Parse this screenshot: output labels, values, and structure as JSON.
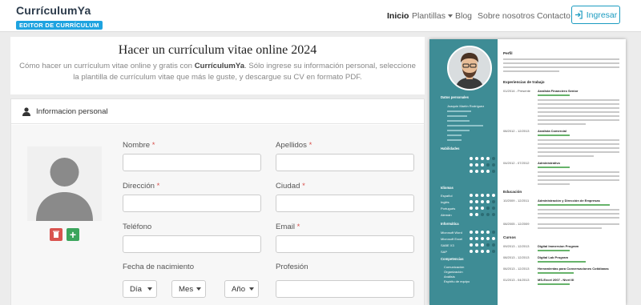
{
  "nav": {
    "logo_title": "CurrículumYa",
    "logo_subtitle": "EDITOR DE CURRÍCULUM",
    "items": [
      "Inicio",
      "Plantillas",
      "Blog",
      "Sobre nosotros",
      "Contacto"
    ],
    "login_label": "Ingresar"
  },
  "hero": {
    "title": "Hacer un currículum vitae online 2024",
    "desc_part1": "Cómo hacer un currículum vitae online y gratis con ",
    "desc_brand": "CurrículumYa",
    "desc_part2": ". Sólo ingrese su información personal, seleccione la plantilla de currículum vitae que más le guste, y descargue su CV en formato PDF."
  },
  "form": {
    "panel_title": "Informacion personal",
    "nombre": "Nombre",
    "apellidos": "Apellidos",
    "direccion": "Dirección",
    "ciudad": "Ciudad",
    "telefono": "Teléfono",
    "email": "Email",
    "fecha": "Fecha de nacimiento",
    "profesion": "Profesión",
    "req": "*",
    "dia": "Día",
    "mes": "Mes",
    "ano": "Año"
  },
  "cv_preview": {
    "perfil": "Perfil",
    "experiencia": "Experiencias de trabajo",
    "educacion": "Educación",
    "cursos": "Cursos",
    "datos": "Datos personales",
    "habilidades": "Habilidades",
    "idiomas": "Idiomas",
    "informatica": "Informática",
    "competencias": "Competencias",
    "name": "Joaquín Martín Rodríguez",
    "job1_date": "01/2014 - Presente",
    "job1_title": "Analista Financiero Senior",
    "job2_date": "08/2012 - 12/2013",
    "job2_title": "Analista Comercial",
    "job3_date": "04/2012 - 07/2012",
    "job3_title": "Administrativo",
    "edu1_date": "10/2009 - 12/2011",
    "edu1_title": "Administración y Dirección de Empresas",
    "edu2_date": "08/2005 - 12/2009",
    "c1_date": "09/2013 - 12/2013",
    "c1_title": "Digital Immersion Program",
    "c2_date": "08/2013 - 12/2013",
    "c2_title": "Digital Lab Program",
    "c3_date": "06/2013 - 12/2013",
    "c3_title": "Herramientas para Conversaciones Cotidianas",
    "c4_date": "01/2013 - 04/2013",
    "c4_title": "MS-Excel 2007 - Nivel III",
    "lang1": "Español",
    "lang2": "Inglés",
    "lang3": "Portugués",
    "lang4": "Alemán",
    "it1": "Microsoft Word",
    "it2": "Microsoft Excel",
    "it3": "SABE X3",
    "it4": "SAP",
    "comp1": "Comunicación",
    "comp2": "Organización",
    "comp3": "Análisis",
    "comp4": "Espíritu de equipo"
  }
}
